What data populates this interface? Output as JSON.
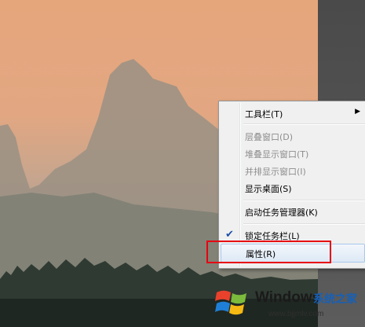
{
  "menu": {
    "items": [
      {
        "label": "工具栏(T)",
        "submenu_arrow": "▶",
        "state": "normal"
      },
      {
        "label": "层叠窗口(D)",
        "state": "disabled"
      },
      {
        "label": "堆叠显示窗口(T)",
        "state": "disabled"
      },
      {
        "label": "并排显示窗口(I)",
        "state": "disabled"
      },
      {
        "label": "显示桌面(S)",
        "state": "normal"
      },
      {
        "label": "启动任务管理器(K)",
        "state": "normal"
      },
      {
        "label": "锁定任务栏(L)",
        "checked": true,
        "check_glyph": "✔",
        "state": "normal"
      },
      {
        "label": "属性(R)",
        "state": "hover"
      }
    ]
  },
  "watermark": {
    "title": "Windows",
    "subtitle": "系统之家",
    "url": "www.bjjmlv.com"
  },
  "colors": {
    "highlight_border": "#e60012",
    "menu_bg": "#f0f0f0",
    "check": "#1c4fa8"
  }
}
